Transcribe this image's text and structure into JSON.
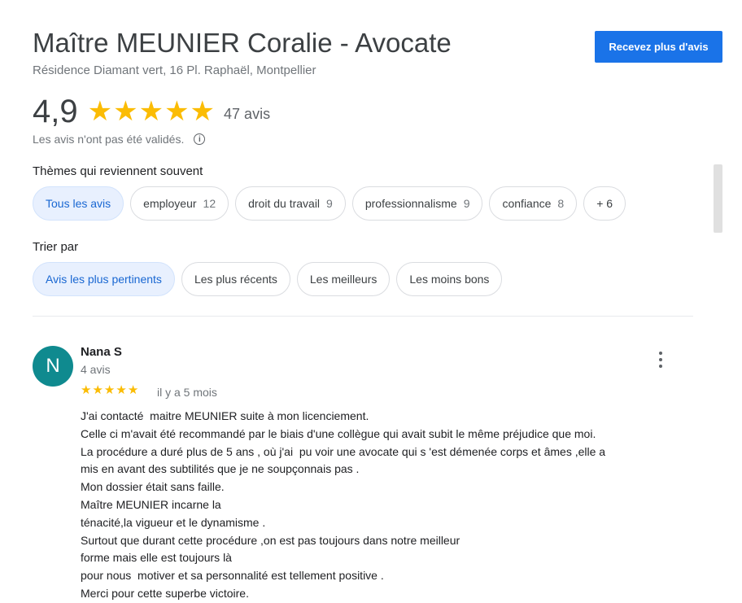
{
  "header": {
    "title": "Maître MEUNIER Coralie - Avocate",
    "address": "Résidence Diamant vert, 16 Pl. Raphaël, Montpellier",
    "cta_label": "Recevez plus d'avis"
  },
  "rating": {
    "value": "4,9",
    "stars": 5,
    "count_label": "47 avis",
    "validation_note": "Les avis n'ont pas été validés.",
    "info_glyph": "i"
  },
  "themes": {
    "label": "Thèmes qui reviennent souvent",
    "chips": [
      {
        "label": "Tous les avis",
        "count": ""
      },
      {
        "label": "employeur",
        "count": "12"
      },
      {
        "label": "droit du travail",
        "count": "9"
      },
      {
        "label": "professionnalisme",
        "count": "9"
      },
      {
        "label": "confiance",
        "count": "8"
      },
      {
        "label": "+ 6",
        "count": ""
      }
    ]
  },
  "sort": {
    "label": "Trier par",
    "options": [
      "Avis les plus pertinents",
      "Les plus récents",
      "Les meilleurs",
      "Les moins bons"
    ]
  },
  "review": {
    "avatar_letter": "N",
    "avatar_color": "#0f8a8f",
    "name": "Nana S",
    "meta": "4 avis",
    "stars": 5,
    "date": "il y a 5 mois",
    "lines": [
      "J'ai contacté  maitre MEUNIER suite à mon licenciement.",
      "Celle ci m'avait été recommandé par le biais d'une collègue qui avait subit le même préjudice que moi.",
      "La procédure a duré plus de 5 ans , où j'ai  pu voir une avocate qui s 'est démenée corps et âmes ,elle a",
      "mis en avant des subtilités que je ne soupçonnais pas .",
      "Mon dossier était sans faille.",
      "Maître MEUNIER incarne la",
      "ténacité,la vigueur et le dynamisme .",
      "Surtout que durant cette procédure ,on est pas toujours dans notre meilleur",
      "forme mais elle est toujours là",
      "pour nous  motiver et sa personnalité est tellement positive .",
      "Merci pour cette superbe victoire."
    ]
  },
  "colors": {
    "accent": "#1a73e8",
    "star": "#fbbc04",
    "chip_active_bg": "#e8f0fe",
    "chip_active_text": "#1967d2"
  }
}
